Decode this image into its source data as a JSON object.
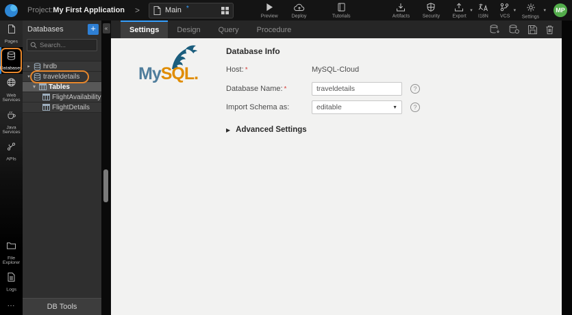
{
  "header": {
    "project_label": "Project:",
    "project_name": "My First Application",
    "page_tab": {
      "name": "Main",
      "modified": "*"
    },
    "preview": "Preview",
    "deploy": "Deploy",
    "tutorials": "Tutorials",
    "artifacts": "Artifacts",
    "security": "Security",
    "export": "Export",
    "i18n": "I18N",
    "vcs": "VCS",
    "settings": "Settings",
    "avatar_initials": "MP"
  },
  "sidebar": {
    "items": [
      {
        "label": "Pages"
      },
      {
        "label": "Databases"
      },
      {
        "label": "Web Services"
      },
      {
        "label": "Java Services"
      },
      {
        "label": "APIs"
      }
    ],
    "bottom_items": [
      {
        "label": "File Explorer"
      },
      {
        "label": "Logs"
      }
    ],
    "more_label": "..."
  },
  "db_panel": {
    "title": "Databases",
    "add_label": "+",
    "collapse_label": "«",
    "search_placeholder": "Search...",
    "tree": [
      {
        "label": "hrdb"
      },
      {
        "label": "traveldetails"
      },
      {
        "label": "Tables"
      },
      {
        "label": "FlightAvailability"
      },
      {
        "label": "FlightDetails"
      }
    ],
    "footer_label": "DB Tools"
  },
  "content": {
    "tabs": [
      {
        "label": "Settings"
      },
      {
        "label": "Design"
      },
      {
        "label": "Query"
      },
      {
        "label": "Procedure"
      }
    ],
    "active_tab": "Settings",
    "toolbar_icons": [
      "db-import-icon",
      "db-reimport-icon",
      "save-icon",
      "delete-icon"
    ],
    "logo": {
      "my": "My",
      "sql": "SQL",
      "dot": "."
    },
    "form": {
      "title": "Database Info",
      "host_label": "Host:",
      "host_value": "MySQL-Cloud",
      "dbname_label": "Database Name:",
      "dbname_value": "traveldetails",
      "schema_label": "Import Schema as:",
      "schema_value": "editable",
      "required_mark": "*",
      "help_glyph": "?",
      "advanced_label": "Advanced Settings"
    }
  },
  "glyphs": {
    "breadcrumb_chevron": ">",
    "collapsed": "▸",
    "expanded": "▾",
    "select_caret": "▼",
    "advanced_arrow": "▶",
    "dropdown_caret": "▾"
  },
  "colors": {
    "accent_blue": "#35a0ff",
    "annotation_orange": "#e8872c",
    "avatar_green": "#53ad4b",
    "mysql_blue": "#4f7d9c",
    "mysql_orange": "#e08c00"
  }
}
